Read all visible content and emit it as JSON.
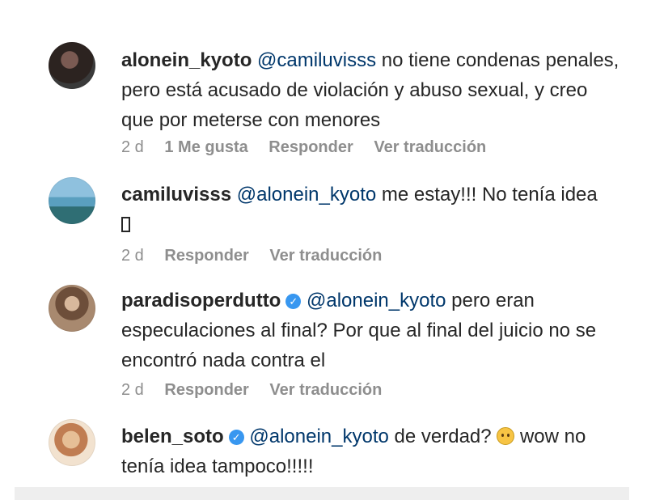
{
  "comments": [
    {
      "username": "alonein_kyoto",
      "verified": false,
      "mention": "@camiluvisss",
      "text": " no tiene condenas penales, pero está acusado de violación y abuso sexual, y creo que por meterse con menores",
      "time": "2 d",
      "likes": "1 Me gusta",
      "reply": "Responder",
      "translate": "Ver traducción"
    },
    {
      "username": "camiluvisss",
      "verified": false,
      "mention": "@alonein_kyoto",
      "text": " me estay!!! No tenía idea",
      "time": "2 d",
      "reply": "Responder",
      "translate": "Ver traducción"
    },
    {
      "username": "paradisoperdutto",
      "verified": true,
      "mention": "@alonein_kyoto",
      "text": " pero eran especulaciones al final? Por que al final del juicio no se encontró nada contra el",
      "time": "2 d",
      "reply": "Responder",
      "translate": "Ver traducción"
    },
    {
      "username": "belen_soto",
      "verified": true,
      "mention": "@alonein_kyoto",
      "text_before_emoji": " de verdad? ",
      "emoji": "worried-face-emoji",
      "text_after_emoji": " wow no tenía idea tampoco!!!!!"
    }
  ],
  "colors": {
    "text": "#262626",
    "mention": "#00376b",
    "meta": "#8e8e8e",
    "verified": "#3897f0"
  }
}
